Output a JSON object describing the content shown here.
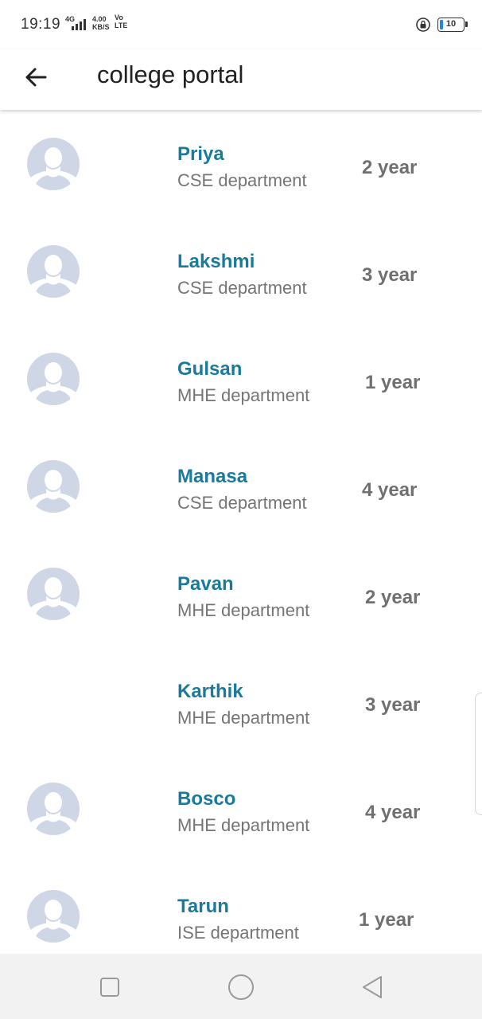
{
  "status_bar": {
    "time": "19:19",
    "network_type": "4G",
    "data_speed": "4.00",
    "data_speed_unit": "KB/S",
    "volte_top": "Vo",
    "volte_bottom": "LTE",
    "battery_level": "10",
    "icons": [
      "signal-icon",
      "lock-rotation-icon",
      "battery-icon"
    ]
  },
  "app_bar": {
    "title": "college portal",
    "back_icon": "arrow-left-icon"
  },
  "students": [
    {
      "name": "Priya",
      "department": "CSE department",
      "year": "2 year",
      "has_avatar": true
    },
    {
      "name": "Lakshmi",
      "department": "CSE department",
      "year": "3 year",
      "has_avatar": true
    },
    {
      "name": "Gulsan",
      "department": "MHE department",
      "year": "1 year",
      "has_avatar": true
    },
    {
      "name": "Manasa",
      "department": "CSE department",
      "year": "4 year",
      "has_avatar": true
    },
    {
      "name": "Pavan",
      "department": "MHE department",
      "year": "2 year",
      "has_avatar": true
    },
    {
      "name": "Karthik",
      "department": "MHE department",
      "year": "3 year",
      "has_avatar": false
    },
    {
      "name": "Bosco",
      "department": "MHE department",
      "year": "4 year",
      "has_avatar": true
    },
    {
      "name": "Tarun",
      "department": "ISE department",
      "year": "1 year",
      "has_avatar": true
    }
  ],
  "nav_bar": {
    "buttons": [
      "recents-square-icon",
      "home-circle-icon",
      "back-triangle-icon"
    ]
  },
  "colors": {
    "name_accent": "#1a7a9c",
    "secondary_text": "#757575",
    "year_text": "#707070",
    "avatar_bg": "#cfd6e6",
    "nav_bar_bg": "#f2f2f2"
  }
}
